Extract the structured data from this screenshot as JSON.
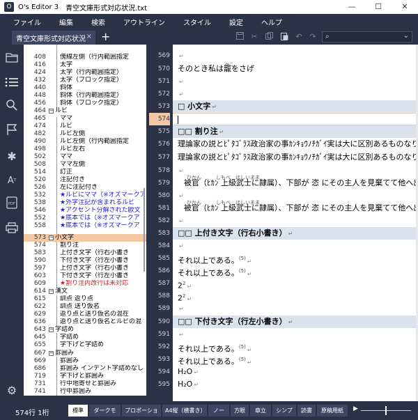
{
  "window": {
    "app_name": "O's Editor 3",
    "file_name": "青空文庫形式対応状況.txt",
    "minimize": "—",
    "maximize": "☐",
    "close": "✕"
  },
  "menu": [
    "ファイル",
    "編集",
    "検索",
    "アウトライン",
    "スタイル",
    "設定",
    "ヘルプ"
  ],
  "tab": {
    "label": "青空文庫形式対応状況",
    "close": "×",
    "add": "+"
  },
  "toolbar_icons": [
    "save-icon",
    "cut-icon",
    "copy-icon",
    "paste-icon",
    "undo-icon",
    "redo-icon"
  ],
  "search": {
    "icon": "⌕",
    "caret": "⌄"
  },
  "sidebar_icons": [
    "folder-icon",
    "outline-list-icon",
    "search-icon",
    "flag-icon",
    "asterisk-icon",
    "font-size-icon",
    "pdf-icon",
    "print-icon",
    "settings-icon"
  ],
  "outline": [
    {
      "ln": "408",
      "text": "傍線左側（行内範囲指定",
      "color": "#000"
    },
    {
      "ln": "416",
      "text": "太字",
      "color": "#000"
    },
    {
      "ln": "424",
      "text": "太字（行内範囲指定）",
      "color": "#000"
    },
    {
      "ln": "432",
      "text": "太字（ブロック指定）",
      "color": "#000"
    },
    {
      "ln": "440",
      "text": "斜体",
      "color": "#000"
    },
    {
      "ln": "448",
      "text": "斜体（行内範囲指定）",
      "color": "#000"
    },
    {
      "ln": "456",
      "text": "斜体（ブロック指定）",
      "color": "#000"
    },
    {
      "ln": "464",
      "text": "ルビ",
      "color": "#000"
    },
    {
      "ln": "465",
      "text": "ママ",
      "color": "#000"
    },
    {
      "ln": "474",
      "text": "ルビ",
      "color": "#000"
    },
    {
      "ln": "482",
      "text": "ルビ左側",
      "color": "#000"
    },
    {
      "ln": "490",
      "text": "ルビ左側（行内範囲指定",
      "color": "#000"
    },
    {
      "ln": "498",
      "text": "ルビ左右",
      "color": "#000"
    },
    {
      "ln": "502",
      "text": "ママ",
      "color": "#000"
    },
    {
      "ln": "508",
      "text": "ママ左側",
      "color": "#000"
    },
    {
      "ln": "514",
      "text": "訂正",
      "color": "#000"
    },
    {
      "ln": "520",
      "text": "注記付き",
      "color": "#000"
    },
    {
      "ln": "526",
      "text": "左に注記付き",
      "color": "#000"
    },
    {
      "ln": "532",
      "text": "★ルビにママ（※オズマークア",
      "color": "#1a1ad6"
    },
    {
      "ln": "538",
      "text": "★外字注記が含まれるルビ",
      "color": "#1a1ad6"
    },
    {
      "ln": "546",
      "text": "★アクセント分解された欧文",
      "color": "#1a1ad6"
    },
    {
      "ln": "552",
      "text": "★底本では（※オズマークア",
      "color": "#1a1ad6"
    },
    {
      "ln": "558",
      "text": "★底本では（※オズマークア",
      "color": "#1a1ad6"
    },
    {
      "ln": "573",
      "text": "小文字",
      "color": "#000"
    },
    {
      "ln": "574",
      "text": "割り注",
      "color": "#000"
    },
    {
      "ln": "583",
      "text": "上付き文字（行右小書き",
      "color": "#000"
    },
    {
      "ln": "590",
      "text": "下付き文字（行左小書き",
      "color": "#000"
    },
    {
      "ln": "597",
      "text": "上付き文字（行右小書き",
      "color": "#000"
    },
    {
      "ln": "603",
      "text": "下付き文字（行左小書き",
      "color": "#000"
    },
    {
      "ln": "609",
      "text": "★割り注内改行は未対応",
      "color": "#d61a1a"
    },
    {
      "ln": "614",
      "text": "漢文",
      "color": "#000"
    },
    {
      "ln": "615",
      "text": "訓点 返り点",
      "color": "#000"
    },
    {
      "ln": "622",
      "text": "訓点 送り仮名",
      "color": "#000"
    },
    {
      "ln": "629",
      "text": "返り点と送り仮名の混在",
      "color": "#000"
    },
    {
      "ln": "636",
      "text": "返り点と送り仮名とルビの混",
      "color": "#000"
    },
    {
      "ln": "643",
      "text": "字詰め",
      "color": "#000"
    },
    {
      "ln": "645",
      "text": "字詰め",
      "color": "#000"
    },
    {
      "ln": "655",
      "text": "字下げと字詰め",
      "color": "#000"
    },
    {
      "ln": "667",
      "text": "罫囲み",
      "color": "#000"
    },
    {
      "ln": "669",
      "text": "罫囲み",
      "color": "#000"
    },
    {
      "ln": "686",
      "text": "罫囲み インデント字詰めなし",
      "color": "#000"
    },
    {
      "ln": "719",
      "text": "字下げと罫囲み",
      "color": "#000"
    },
    {
      "ln": "731",
      "text": "行中地寄せと罫囲み",
      "color": "#000"
    },
    {
      "ln": "741",
      "text": "行中罫囲み",
      "color": "#000"
    }
  ],
  "editor": {
    "line_numbers": [
      "569",
      "570",
      "571",
      "572",
      "573",
      "574",
      "575",
      "576",
      "577",
      "578",
      "579",
      "580",
      "581",
      "582",
      "583",
      "584",
      "585",
      "586",
      "587",
      "588",
      "589",
      "590",
      "591",
      "592",
      "593",
      "594",
      "595"
    ],
    "current_line": "574",
    "lines": [
      {
        "text": "",
        "eol": "↵",
        "head": false
      },
      {
        "text": "そのとき私は籠をさげ",
        "eol": "↵",
        "head": false,
        "ruby": "かご"
      },
      {
        "text": "",
        "eol": "↵",
        "head": false
      },
      {
        "text": "",
        "eol": "↵",
        "head": false
      },
      {
        "text": "□ 小文字",
        "eol": "↵",
        "head": true
      },
      {
        "text": "",
        "eol": "",
        "head": false
      },
      {
        "text": "□□ 割り注",
        "eol": "↵",
        "head": true
      },
      {
        "text": "理論家の説とﾋﾟﾀｺﾞﾗｽ政治家の事ｶﾝｷｮｳﾉﾁｶﾞｲ実は大に区別あるものなり。",
        "eol": "↵",
        "head": false
      },
      {
        "text": "理論家の説とﾋﾟﾀｺﾞﾗｽ政治家の事ｶﾝｷｮｳﾉﾁｶﾞｲ実は大に区別あるものなり。",
        "eol": "↵",
        "head": false
      },
      {
        "text": "",
        "eol": "↵",
        "head": false
      },
      {
        "text": "被官（ﾋｶﾝ 上級武士に隷属）、下部が 恣 にその主人を見棄てて他へ出奔し、",
        "eol": "",
        "head": false,
        "ruby": "ひかん　　　しもべ　ほしいまま"
      },
      {
        "text": "",
        "eol": "↵",
        "head": false
      },
      {
        "text": "被官（ﾋｶﾝ 上級武士に隷属）、下部が 恣 にその主人を見棄てて他へ出奔し、",
        "eol": "",
        "head": false,
        "ruby": "ひかん　　　しもべ　ほしいまま"
      },
      {
        "text": "",
        "eol": "↵",
        "head": false
      },
      {
        "text": "□□ 上付き文字（行右小書き）",
        "eol": "↵",
        "head": true
      },
      {
        "text": "",
        "eol": "↵",
        "head": false
      },
      {
        "text": "それ以上である。",
        "eol": "↵",
        "head": false,
        "sup": "(5)"
      },
      {
        "text": "それ以上である。",
        "eol": "↵",
        "head": false,
        "sup": "(5)"
      },
      {
        "text": "2",
        "eol": "↵",
        "head": false,
        "sup": "2"
      },
      {
        "text": "2",
        "eol": "↵",
        "head": false,
        "sup": "2"
      },
      {
        "text": "",
        "eol": "↵",
        "head": false
      },
      {
        "text": "□□ 下付き文字（行左小書き）",
        "eol": "↵",
        "head": true
      },
      {
        "text": "",
        "eol": "↵",
        "head": false
      },
      {
        "text": "それ以上である。",
        "eol": "↵",
        "head": false,
        "sup": "(5)"
      },
      {
        "text": "それ以上である。",
        "eol": "↵",
        "head": false,
        "sup": "(5)"
      },
      {
        "text": "H₂O",
        "eol": "↵",
        "head": false
      },
      {
        "text": "H₂O",
        "eol": "↵",
        "head": false
      }
    ]
  },
  "status": {
    "position": "574行 1桁",
    "styles": [
      "標準",
      "ダークモード",
      "プロポーショナル",
      "A4縦（横書き）",
      "ノート",
      "方眼",
      "章立て",
      "シンプル",
      "読書",
      "原稿用紙"
    ],
    "active_style": "標準",
    "more_caret": "▶",
    "zoom_level": 0.5
  }
}
